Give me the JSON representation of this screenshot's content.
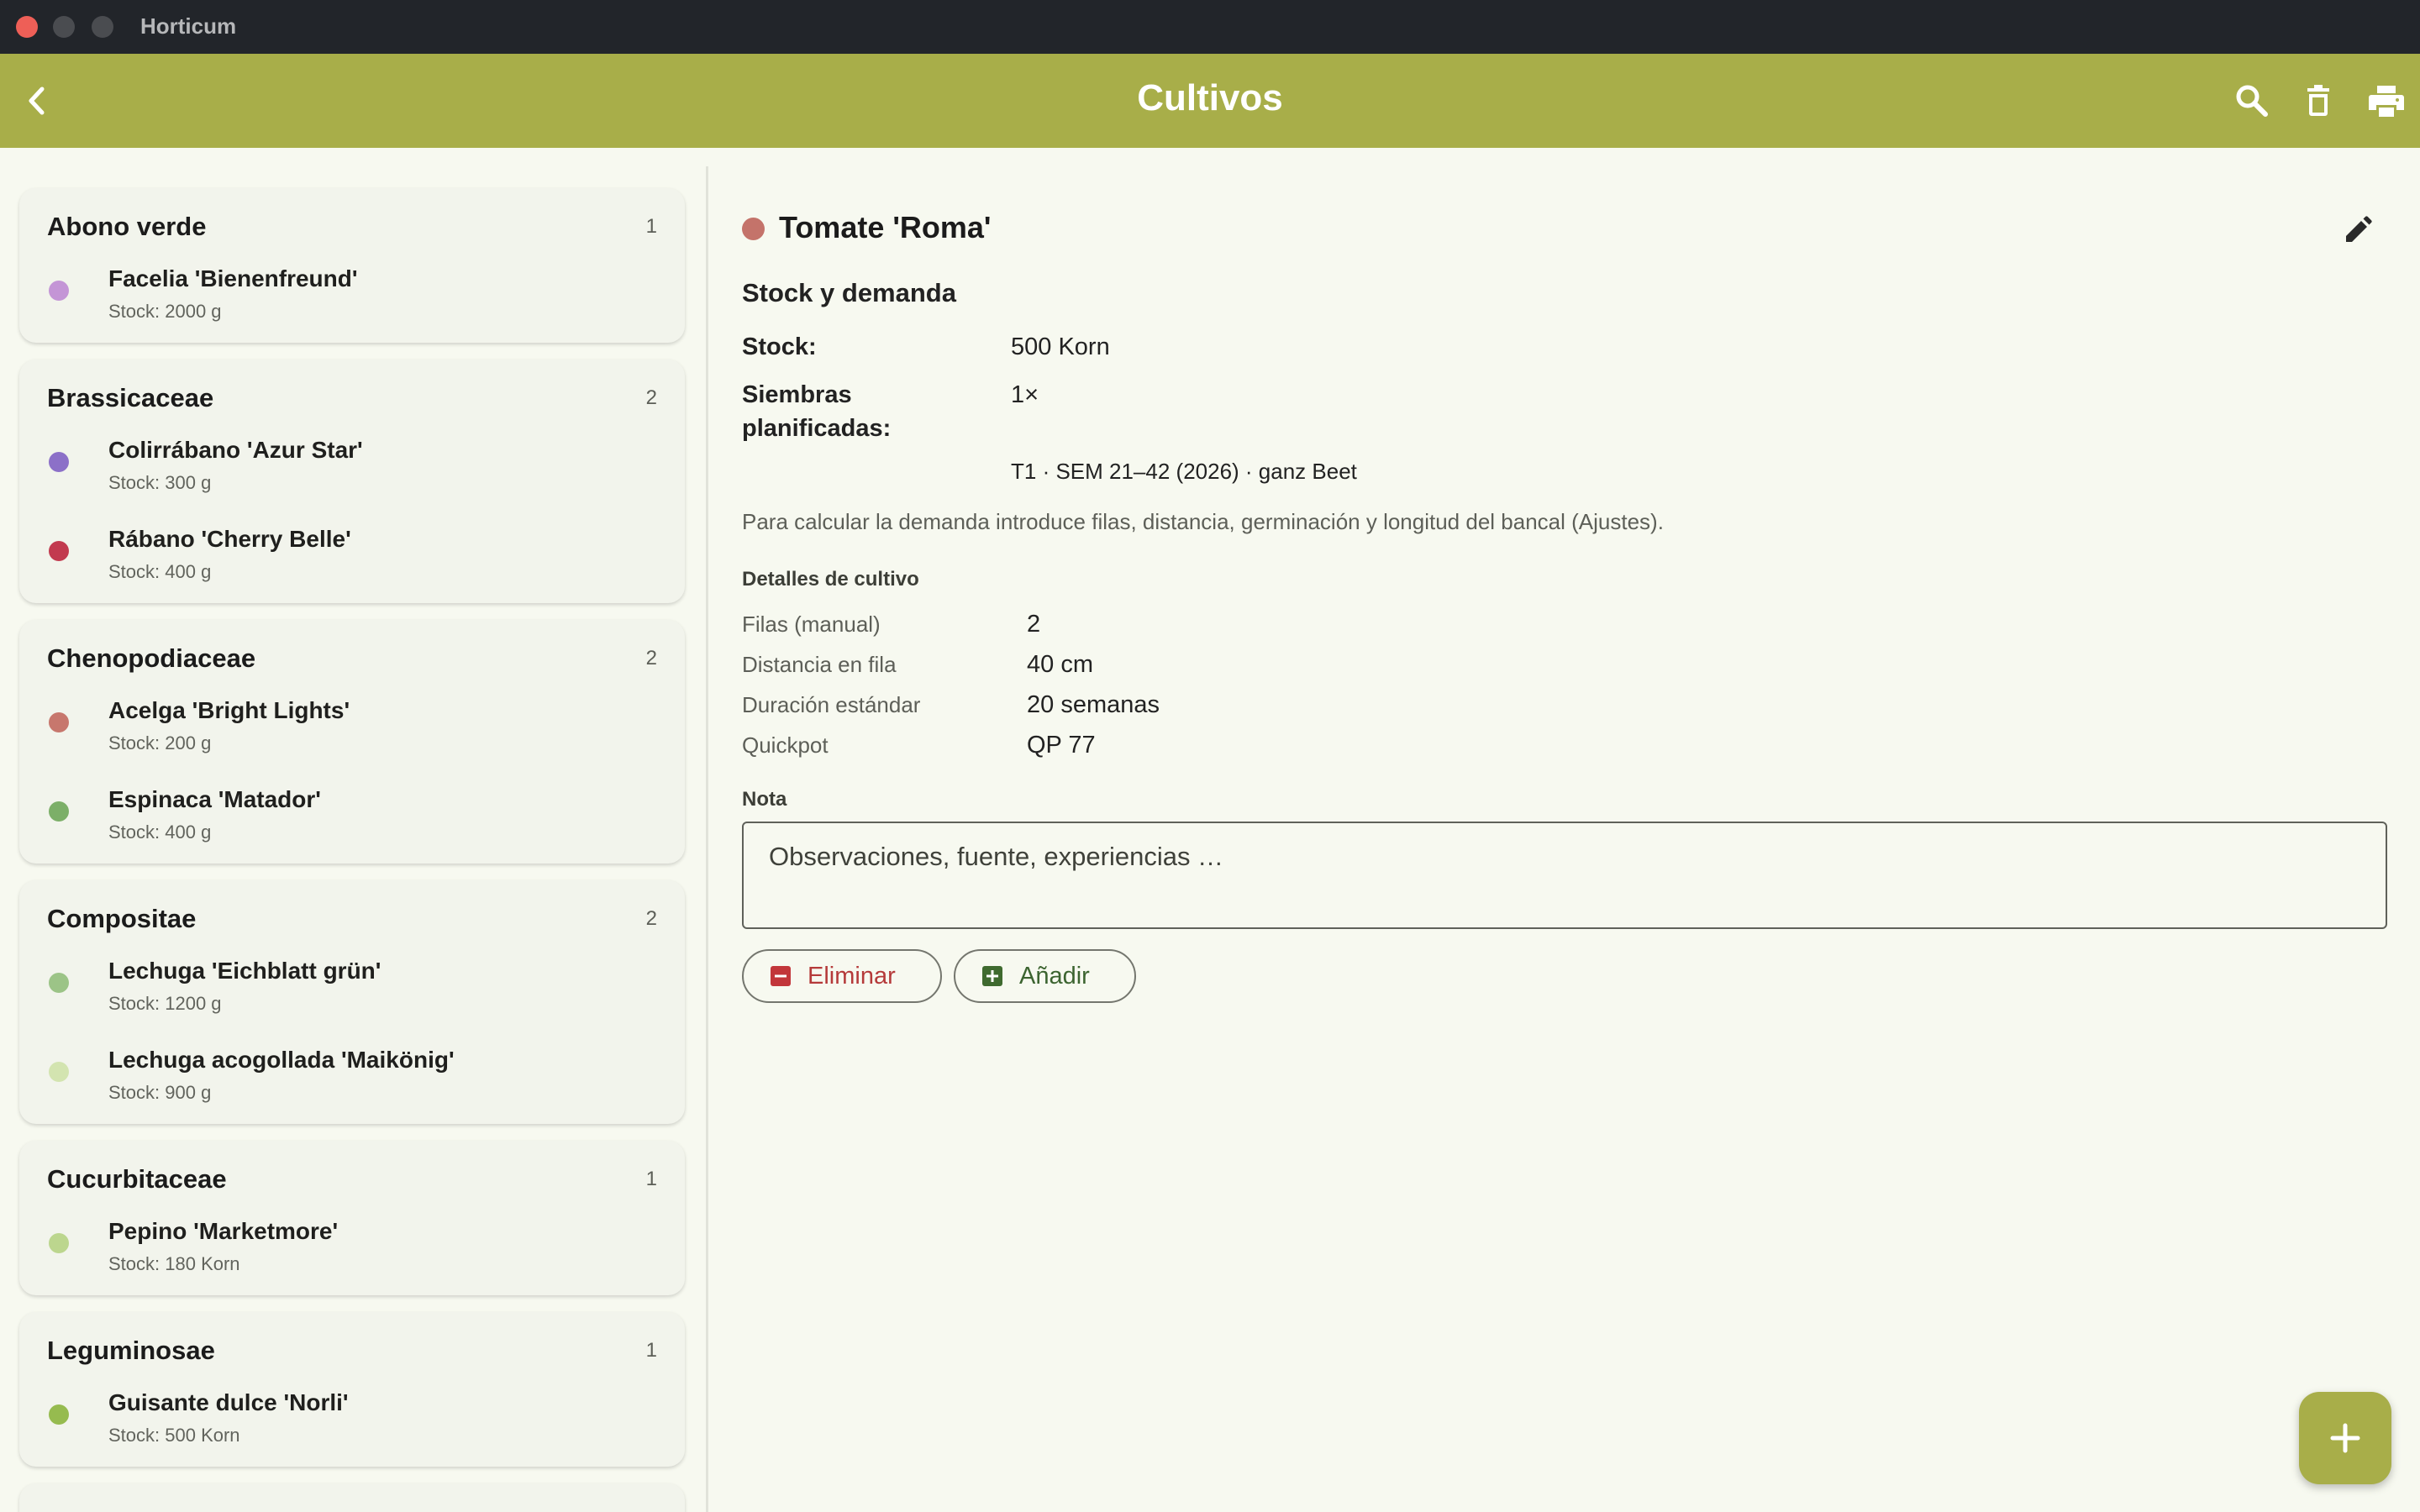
{
  "window": {
    "title": "Horticum"
  },
  "appbar": {
    "title": "Cultivos",
    "icons": [
      "arrow-back-icon",
      "search-icon",
      "delete-icon",
      "print-icon"
    ]
  },
  "groups": [
    {
      "name": "Abono verde",
      "count": "1",
      "items": [
        {
          "name": "Facelia 'Bienenfreund'",
          "stock": "Stock: 2000 g",
          "color": "#c495d6"
        }
      ]
    },
    {
      "name": "Brassicaceae",
      "count": "2",
      "items": [
        {
          "name": "Colirrábano 'Azur Star'",
          "stock": "Stock: 300 g",
          "color": "#8c70c8"
        },
        {
          "name": "Rábano 'Cherry Belle'",
          "stock": "Stock: 400 g",
          "color": "#c23a4f"
        }
      ]
    },
    {
      "name": "Chenopodiaceae",
      "count": "2",
      "items": [
        {
          "name": "Acelga 'Bright Lights'",
          "stock": "Stock: 200 g",
          "color": "#c7776d"
        },
        {
          "name": "Espinaca 'Matador'",
          "stock": "Stock: 400 g",
          "color": "#7caf68"
        }
      ]
    },
    {
      "name": "Compositae",
      "count": "2",
      "items": [
        {
          "name": "Lechuga 'Eichblatt grün'",
          "stock": "Stock: 1200 g",
          "color": "#9cc487"
        },
        {
          "name": "Lechuga acogollada 'Maikönig'",
          "stock": "Stock: 900 g",
          "color": "#d3e4b0"
        }
      ]
    },
    {
      "name": "Cucurbitaceae",
      "count": "1",
      "items": [
        {
          "name": "Pepino 'Marketmore'",
          "stock": "Stock: 180 Korn",
          "color": "#bcd68e"
        }
      ]
    },
    {
      "name": "Leguminosae",
      "count": "1",
      "items": [
        {
          "name": "Guisante dulce 'Norli'",
          "stock": "Stock: 500 Korn",
          "color": "#96bb4f"
        }
      ]
    }
  ],
  "detail": {
    "title": "Tomate 'Roma'",
    "color": "#c4736a",
    "section_title": "Stock y demanda",
    "stock_label": "Stock:",
    "stock_value": "500 Korn",
    "sowings_label_1": "Siembras",
    "sowings_label_2": "planificadas:",
    "sowings_value": "1×",
    "sowing_line": "T1 · SEM 21–42 (2026) · ganz Beet",
    "hint": "Para calcular la demanda introduce filas, distancia, germinación y longitud del bancal (Ajustes).",
    "details_title": "Detalles de cultivo",
    "details": [
      {
        "label": "Filas (manual)",
        "value": "2"
      },
      {
        "label": "Distancia en fila",
        "value": "40 cm"
      },
      {
        "label": "Duración estándar",
        "value": "20 semanas"
      },
      {
        "label": "Quickpot",
        "value": "QP 77"
      }
    ],
    "note_label": "Nota",
    "note_placeholder": "Observaciones, fuente, experiencias …",
    "delete_label": "Eliminar",
    "add_label": "Añadir"
  },
  "colors": {
    "appbar": "#a8ae49",
    "background": "#f7f9f0",
    "delete": "#c2363a",
    "add": "#3f6a2f"
  }
}
